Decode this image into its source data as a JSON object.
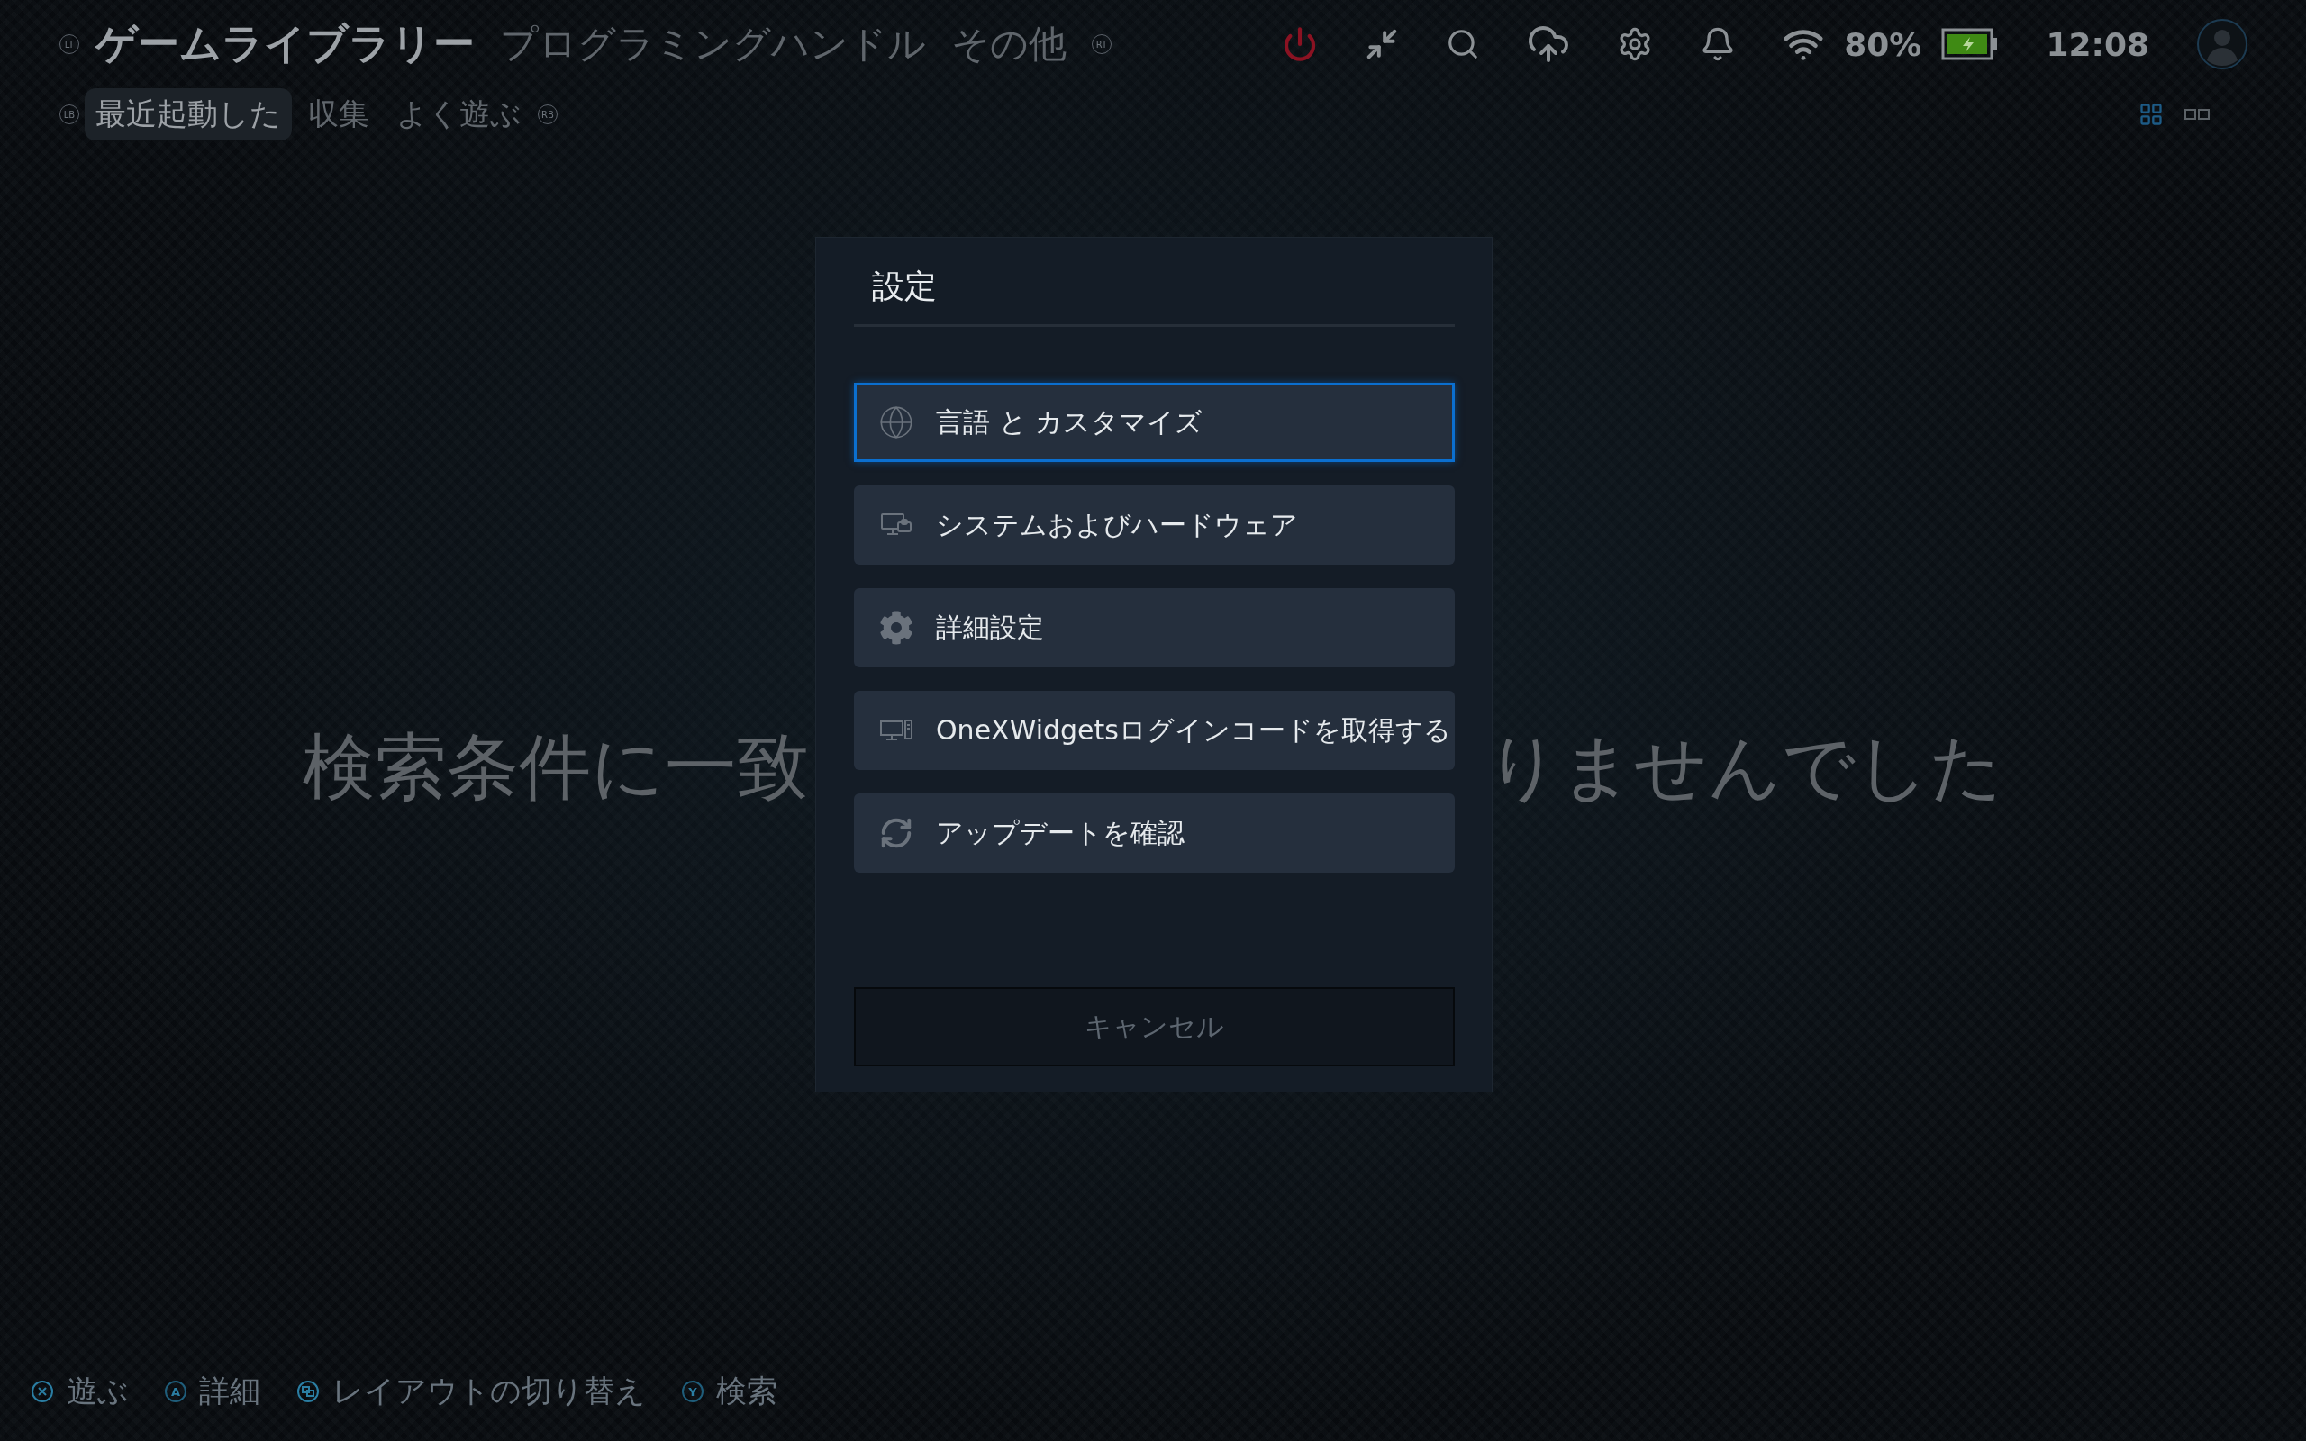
{
  "header": {
    "left_trigger": "LT",
    "tabs": [
      {
        "label": "ゲームライブラリー",
        "selected": true
      },
      {
        "label": "プログラミングハンドル",
        "selected": false
      },
      {
        "label": "その他",
        "selected": false
      }
    ],
    "right_trigger": "RT"
  },
  "subheader": {
    "left_bumper": "LB",
    "tabs": [
      {
        "label": "最近起動した",
        "selected": true
      },
      {
        "label": "収集",
        "selected": false
      },
      {
        "label": "よく遊ぶ",
        "selected": false
      }
    ],
    "right_bumper": "RB"
  },
  "status": {
    "battery": "80%",
    "time": "12:08"
  },
  "view_modes": [
    {
      "kind": "grid",
      "selected": true
    },
    {
      "kind": "pair",
      "selected": false
    }
  ],
  "empty_message": [
    "検索条件に一致",
    "りませんでした"
  ],
  "dialog": {
    "title": "設定",
    "items": [
      {
        "kind": "globe",
        "label": "言語 と カスタマイズ",
        "selected": true
      },
      {
        "kind": "devices",
        "label": "システムおよびハードウェア",
        "selected": false
      },
      {
        "kind": "gear",
        "label": "詳細設定",
        "selected": false
      },
      {
        "kind": "monitor",
        "label": "OneXWidgetsログインコードを取得する",
        "selected": false
      },
      {
        "kind": "refresh",
        "label": "アップデートを確認",
        "selected": false
      }
    ],
    "cancel": "キャンセル"
  },
  "hints": [
    {
      "kind": "cross",
      "label": "遊ぶ"
    },
    {
      "kind": "letter",
      "key": "A",
      "label": "詳細"
    },
    {
      "kind": "layout",
      "label": "レイアウトの切り替え"
    },
    {
      "kind": "letter",
      "key": "Y",
      "label": "検索"
    }
  ]
}
